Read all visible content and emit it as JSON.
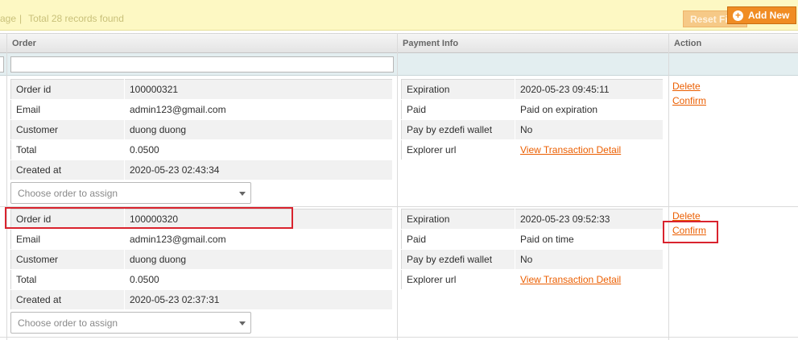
{
  "pager": {
    "page_fragment": "age",
    "separator": "|",
    "total": "Total 28 records found"
  },
  "toolbar": {
    "reset_label": "Reset Filter",
    "add_label": "Add New"
  },
  "columns": {
    "order": "Order",
    "payment": "Payment Info",
    "action": "Action"
  },
  "select_placeholder": "Choose order to assign",
  "actions": {
    "delete": "Delete",
    "confirm": "Confirm"
  },
  "records": [
    {
      "order": [
        {
          "label": "Order id",
          "value": "100000321"
        },
        {
          "label": "Email",
          "value": "admin123@gmail.com"
        },
        {
          "label": "Customer",
          "value": "duong duong"
        },
        {
          "label": "Total",
          "value": "0.0500"
        },
        {
          "label": "Created at",
          "value": "2020-05-23 02:43:34"
        }
      ],
      "payment": [
        {
          "label": "Expiration",
          "value": "2020-05-23 09:45:11"
        },
        {
          "label": "Paid",
          "value": "Paid on expiration"
        },
        {
          "label": "Pay by ezdefi wallet",
          "value": "No"
        },
        {
          "label": "Explorer url",
          "value": "View Transaction Detail"
        }
      ]
    },
    {
      "order": [
        {
          "label": "Order id",
          "value": "100000320"
        },
        {
          "label": "Email",
          "value": "admin123@gmail.com"
        },
        {
          "label": "Customer",
          "value": "duong duong"
        },
        {
          "label": "Total",
          "value": "0.0500"
        },
        {
          "label": "Created at",
          "value": "2020-05-23 02:37:31"
        }
      ],
      "payment": [
        {
          "label": "Expiration",
          "value": "2020-05-23 09:52:33"
        },
        {
          "label": "Paid",
          "value": "Paid on time"
        },
        {
          "label": "Pay by ezdefi wallet",
          "value": "No"
        },
        {
          "label": "Explorer url",
          "value": "View Transaction Detail"
        }
      ]
    }
  ]
}
